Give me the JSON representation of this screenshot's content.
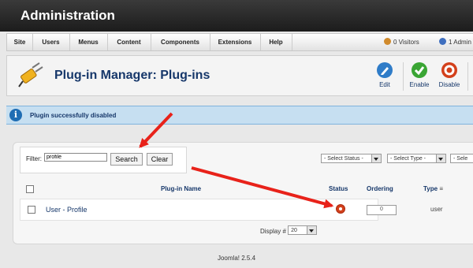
{
  "header": {
    "title": "Administration"
  },
  "menu": {
    "items": [
      "Site",
      "Users",
      "Menus",
      "Content",
      "Components",
      "Extensions",
      "Help"
    ],
    "visitors": "0 Visitors",
    "admins": "1 Admin"
  },
  "toolbar": {
    "title": "Plug-in Manager: Plug-ins",
    "edit": "Edit",
    "enable": "Enable",
    "disable": "Disable"
  },
  "message": {
    "text": "Plugin successfully disabled"
  },
  "filter": {
    "label": "Filter:",
    "value": "profile",
    "search": "Search",
    "clear": "Clear",
    "status_select": "- Select Status -",
    "type_select": "- Select Type -",
    "third_select": "- Sele"
  },
  "table": {
    "headers": {
      "name": "Plug-in Name",
      "status": "Status",
      "ordering": "Ordering",
      "type": "Type"
    },
    "rows": [
      {
        "name": "User - Profile",
        "ordering": "0",
        "type": "user"
      }
    ]
  },
  "display": {
    "label": "Display #",
    "value": "20"
  },
  "footer": {
    "version": "Joomla! 2.5.4"
  },
  "colors": {
    "link": "#16376a",
    "annotation_arrow": "#e8221a",
    "enable": "#3aa534",
    "disable": "#d3401b"
  }
}
